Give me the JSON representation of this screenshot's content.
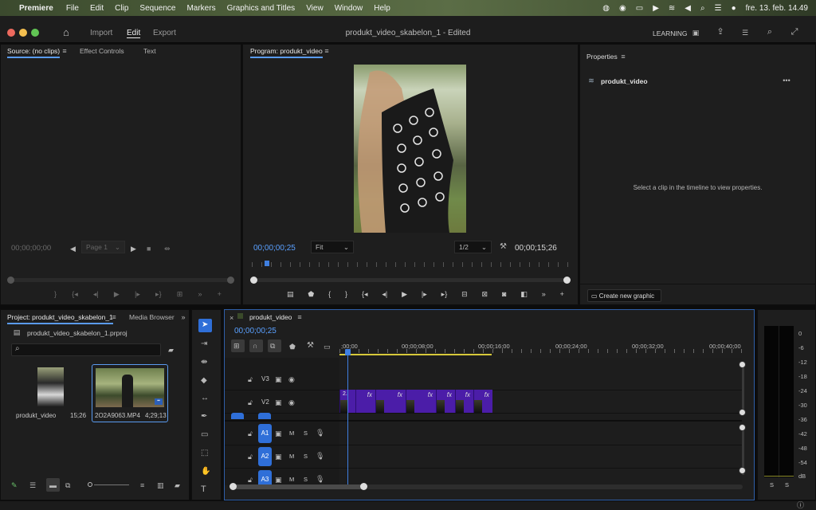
{
  "menubar": {
    "app": "Premiere",
    "items": [
      "File",
      "Edit",
      "Clip",
      "Sequence",
      "Markers",
      "Graphics and Titles",
      "View",
      "Window",
      "Help"
    ],
    "clock": "fre. 13. feb.  14.49"
  },
  "header": {
    "tabs": {
      "import": "Import",
      "edit": "Edit",
      "export": "Export"
    },
    "title": "produkt_video_skabelon_1 - Edited",
    "workspace": "LEARNING"
  },
  "source": {
    "tabs": {
      "source": "Source: (no clips)",
      "effects": "Effect Controls",
      "text": "Text"
    },
    "timecode": "00;00;00;00",
    "page": "Page 1"
  },
  "program": {
    "tab": "Program: produkt_video",
    "timecode": "00;00;00;25",
    "fit": "Fit",
    "resolution": "1/2",
    "duration": "00;00;15;26"
  },
  "properties": {
    "tab": "Properties",
    "item": "produkt_video",
    "hint": "Select a clip in the timeline to view properties.",
    "create_graphic": "Create new graphic"
  },
  "project": {
    "tabs": {
      "project": "Project: produkt_video_skabelon_1",
      "media": "Media Browser"
    },
    "file": "produkt_video_skabelon_1.prproj",
    "items": [
      {
        "name": "produkt_video",
        "duration": "15;26"
      },
      {
        "name": "2O2A9063.MP4",
        "duration": "4;29;13"
      }
    ]
  },
  "timeline": {
    "tab": "produkt_video",
    "timecode": "00;00;00;25",
    "ruler": [
      ";00;00",
      "00;00;08;00",
      "00;00;16;00",
      "00;00;24;00",
      "00;00;32;00",
      "00;00;40;00"
    ],
    "video_tracks": [
      "V3",
      "V2"
    ],
    "audio_tracks": [
      "A1",
      "A2",
      "A3"
    ],
    "track_mute": "M",
    "track_solo": "S",
    "first_clip_label": "2."
  },
  "meter": {
    "scale": [
      "0",
      "-6",
      "-12",
      "-18",
      "-24",
      "-30",
      "-36",
      "-42",
      "-48",
      "-54",
      "dB"
    ],
    "channels": [
      "S",
      "S"
    ]
  },
  "colors": {
    "accent": "#5a9bf0",
    "clip": "#4b1da8",
    "playhead": "#3f7fe0"
  }
}
